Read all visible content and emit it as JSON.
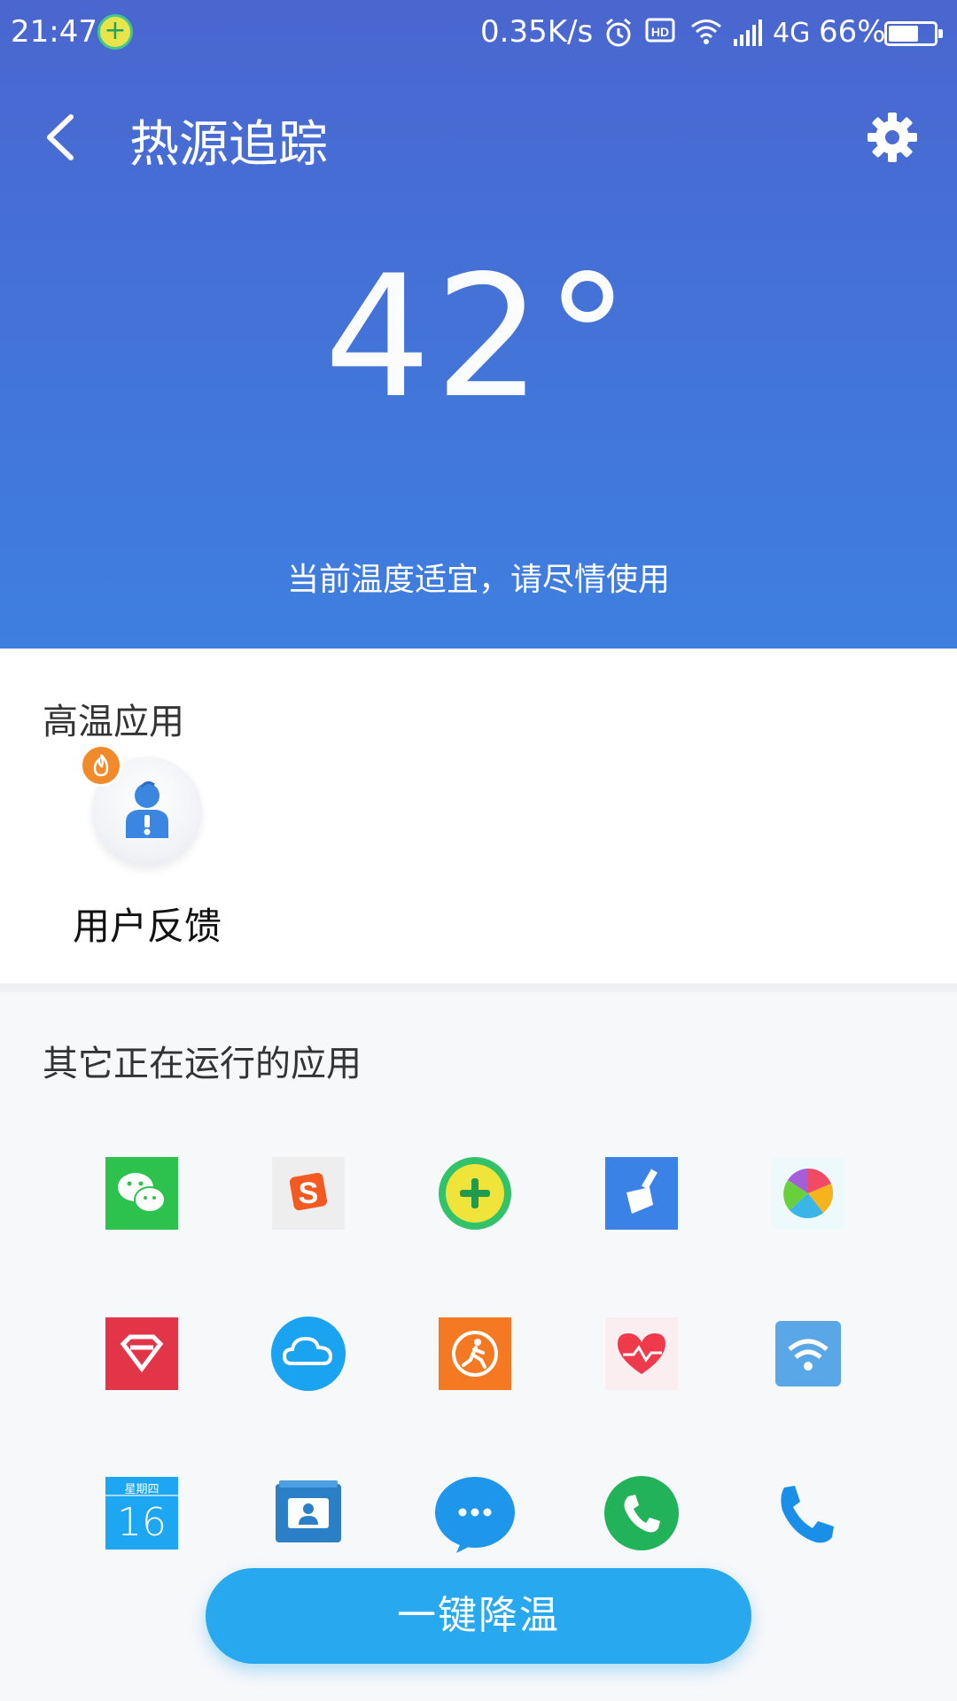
{
  "status_bar": {
    "time": "21:47",
    "network_speed": "0.35K/s",
    "network_type": "4G",
    "battery": "66%",
    "battery_level": 0.66,
    "icons": [
      "360-security-icon",
      "alarm-icon",
      "hd-icon",
      "wifi-icon",
      "signal-icon",
      "battery-icon"
    ]
  },
  "header": {
    "title": "热源追踪",
    "temperature": "42°",
    "message": "当前温度适宜，请尽情使用",
    "gradient_top": "#4a66cf",
    "gradient_bottom": "#3e7fdf"
  },
  "high_temp_section": {
    "title": "高温应用",
    "apps": [
      {
        "label": "用户反馈",
        "icon": "user-feedback-icon",
        "badge": "fire-icon"
      }
    ]
  },
  "running_section": {
    "title": "其它正在运行的应用",
    "apps": [
      {
        "icon": "wechat-icon"
      },
      {
        "icon": "sogou-input-icon"
      },
      {
        "icon": "360-plus-icon"
      },
      {
        "icon": "cleaner-broom-icon"
      },
      {
        "icon": "colorful-ball-icon"
      },
      {
        "icon": "red-diamond-icon"
      },
      {
        "icon": "cloud-icon"
      },
      {
        "icon": "running-man-icon"
      },
      {
        "icon": "health-heart-icon"
      },
      {
        "icon": "wifi-app-icon"
      },
      {
        "icon": "calendar-icon",
        "weekday": "星期四",
        "day": "16"
      },
      {
        "icon": "contacts-icon"
      },
      {
        "icon": "messages-icon"
      },
      {
        "icon": "phone-green-icon"
      },
      {
        "icon": "phone-blue-icon"
      }
    ]
  },
  "cool_button": {
    "label": "一键降温",
    "color": "#27a8ef"
  }
}
